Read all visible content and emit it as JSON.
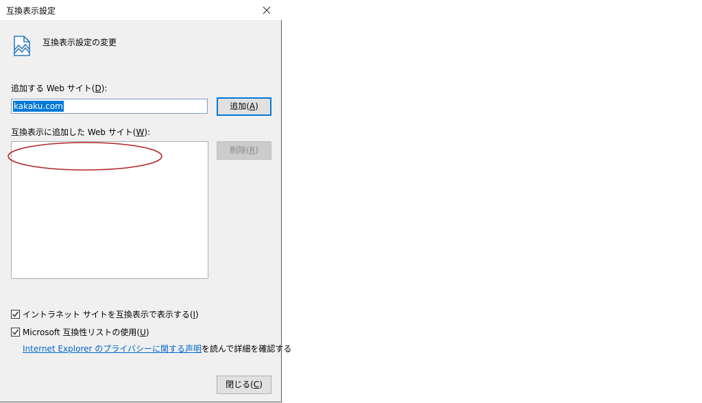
{
  "window": {
    "title": "互換表示設定"
  },
  "header": {
    "text": "互換表示設定の変更",
    "icon": "page-compatibility-icon"
  },
  "add_site": {
    "label_prefix": "追加する Web サイト(",
    "label_key": "D",
    "label_suffix": "):",
    "value": "kakaku.com",
    "button_prefix": "追加(",
    "button_key": "A",
    "button_suffix": ")"
  },
  "site_list": {
    "label_prefix": "互換表示に追加した Web サイト(",
    "label_key": "W",
    "label_suffix": "):",
    "items": [],
    "remove_prefix": "削除(",
    "remove_key": "R",
    "remove_suffix": ")",
    "annotation_color": "#b22222"
  },
  "options": {
    "intranet_text": "イントラネット サイトを互換表示で表示する(",
    "intranet_key": "I",
    "intranet_suffix": ")",
    "intranet_checked": true,
    "mslist_text": "Microsoft 互換性リストの使用(",
    "mslist_key": "U",
    "mslist_suffix": ")",
    "mslist_checked": true
  },
  "privacy": {
    "link_text": "Internet Explorer のプライバシーに関する声明",
    "rest_text": "を読んで詳細を確認する"
  },
  "footer": {
    "close_prefix": "閉じる(",
    "close_key": "C",
    "close_suffix": ")"
  },
  "colors": {
    "accent": "#0078d7",
    "link": "#0066cc",
    "dialog_bg": "#f0f0f0"
  }
}
